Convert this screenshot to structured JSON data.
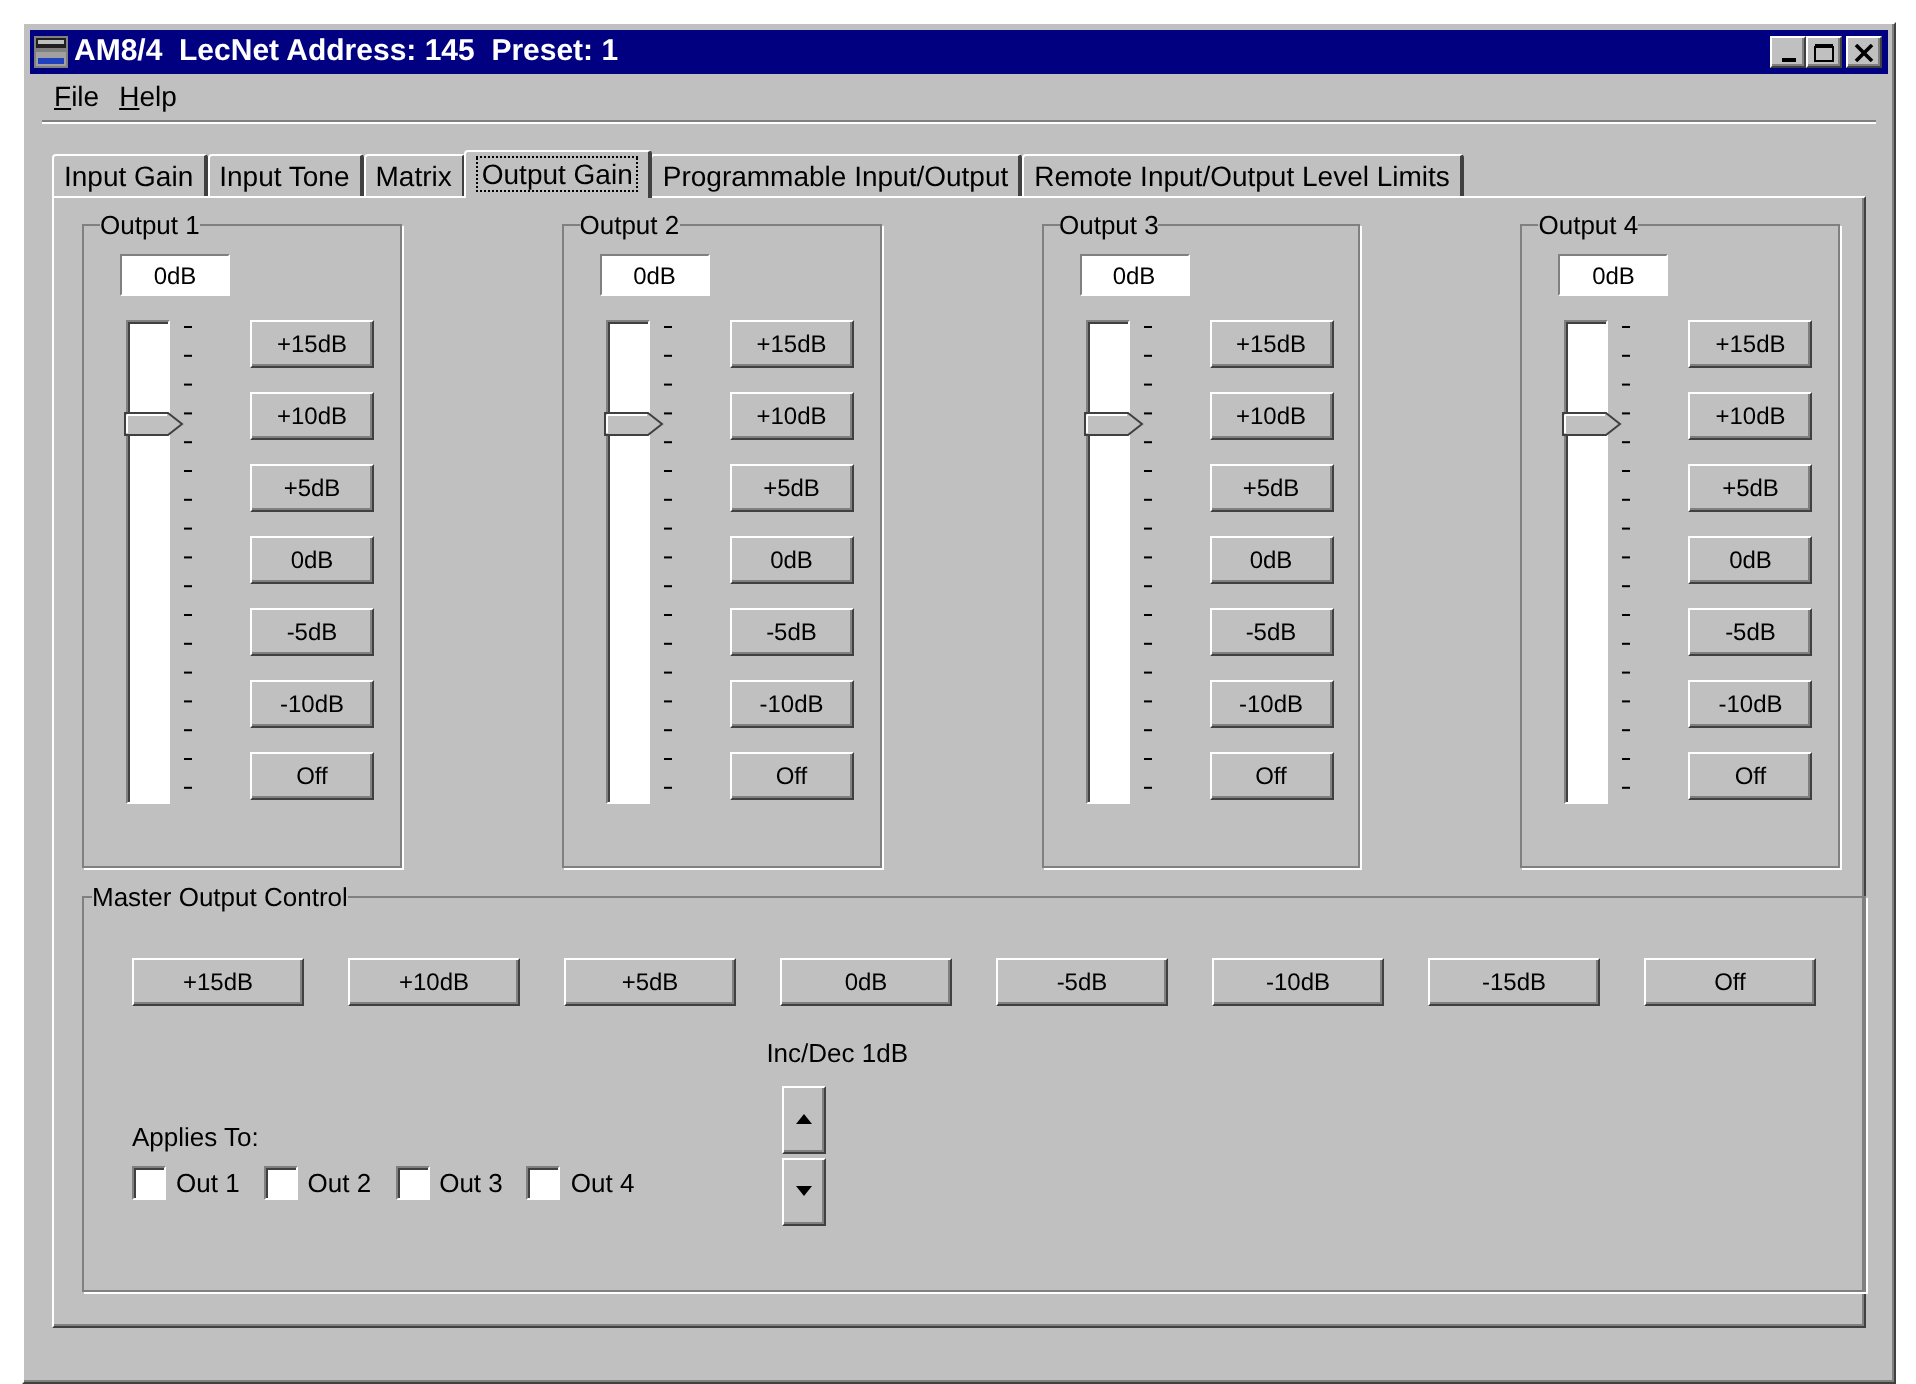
{
  "window": {
    "title": "AM8/4  LecNet Address: 145  Preset: 1"
  },
  "menu": [
    {
      "label": "File"
    },
    {
      "label": "Help"
    }
  ],
  "tabs": [
    {
      "label": "Input  Gain",
      "selected": false
    },
    {
      "label": "Input Tone",
      "selected": false
    },
    {
      "label": "Matrix",
      "selected": false
    },
    {
      "label": "Output Gain",
      "selected": true
    },
    {
      "label": "Programmable Input/Output",
      "selected": false
    },
    {
      "label": "Remote Input/Output Level Limits",
      "selected": false
    }
  ],
  "outputs": [
    {
      "title": "Output 1",
      "value": "0dB",
      "level": 0.8,
      "buttons": [
        "+15dB",
        "+10dB",
        "+5dB",
        "0dB",
        "-5dB",
        "-10dB",
        "Off"
      ]
    },
    {
      "title": "Output 2",
      "value": "0dB",
      "level": 0.8,
      "buttons": [
        "+15dB",
        "+10dB",
        "+5dB",
        "0dB",
        "-5dB",
        "-10dB",
        "Off"
      ]
    },
    {
      "title": "Output 3",
      "value": "0dB",
      "level": 0.8,
      "buttons": [
        "+15dB",
        "+10dB",
        "+5dB",
        "0dB",
        "-5dB",
        "-10dB",
        "Off"
      ]
    },
    {
      "title": "Output 4",
      "value": "0dB",
      "level": 0.8,
      "buttons": [
        "+15dB",
        "+10dB",
        "+5dB",
        "0dB",
        "-5dB",
        "-10dB",
        "Off"
      ]
    }
  ],
  "master": {
    "title": "Master Output Control",
    "buttons": [
      "+15dB",
      "+10dB",
      "+5dB",
      "0dB",
      "-5dB",
      "-10dB",
      "-15dB",
      "Off"
    ],
    "applies_to": "Applies To:",
    "checkboxes": [
      {
        "label": "Out 1",
        "checked": false
      },
      {
        "label": "Out 2",
        "checked": false
      },
      {
        "label": "Out 3",
        "checked": false
      },
      {
        "label": "Out 4",
        "checked": false
      }
    ],
    "step_label": "Inc/Dec 1dB"
  }
}
